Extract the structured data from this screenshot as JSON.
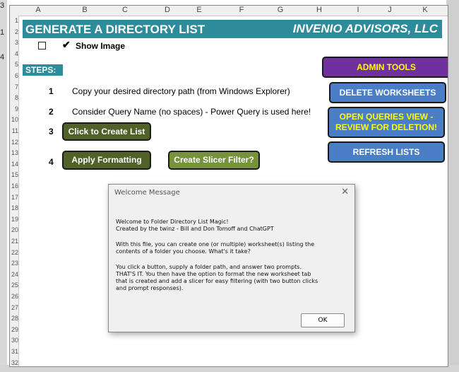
{
  "columns": [
    "A",
    "B",
    "C",
    "D",
    "E",
    "F",
    "G",
    "H",
    "I",
    "J",
    "K"
  ],
  "rows": [
    "1",
    "2",
    "3",
    "4",
    "5",
    "6",
    "7",
    "8",
    "9",
    "10",
    "11",
    "12",
    "13",
    "14",
    "15",
    "16",
    "17",
    "18",
    "19",
    "20",
    "21",
    "22",
    "23",
    "24",
    "25",
    "26",
    "27",
    "28",
    "29",
    "30",
    "31",
    "32"
  ],
  "left_fragments": [
    "3",
    "1",
    "4"
  ],
  "banner": {
    "title": "GENERATE A DIRECTORY LIST",
    "brand": "INVENIO ADVISORS, LLC"
  },
  "show_image": {
    "label": "Show Image",
    "check_glyph": "✔",
    "checked": false
  },
  "steps_label": "STEPS:",
  "steps": [
    {
      "num": "1",
      "text": "Copy your desired directory path (from Windows Explorer)"
    },
    {
      "num": "2",
      "text": "Consider Query Name (no spaces) - Power Query is used here!"
    },
    {
      "num": "3",
      "text": ""
    },
    {
      "num": "4",
      "text": ""
    }
  ],
  "buttons": {
    "create_list": "Click to Create List",
    "apply_formatting": "Apply Formatting",
    "create_slicer": "Create Slicer Filter?",
    "admin_tools": "ADMIN TOOLS",
    "delete_worksheets": "DELETE WORKSHEETS",
    "open_queries_line1": "OPEN QUERIES VIEW -",
    "open_queries_line2": "REVIEW FOR DELETION!",
    "refresh_lists": "REFRESH LISTS"
  },
  "dialog": {
    "title": "Welcome Message",
    "close_glyph": "✕",
    "lines": [
      "Welcome to Folder Directory List Magic!",
      "Created by the twinz - Bill and Don Tomoff and ChatGPT",
      "",
      "With this file, you can create one (or multiple) worksheet(s) listing the",
      "contents of a folder you choose. What's it take?",
      "",
      "You click a button, supply a folder path, and answer two prompts.",
      "THAT'S IT. You then have the option to format the new worksheet tab",
      "that is created and add a slicer for easy filtering (with two button clicks",
      "and prompt responses)."
    ],
    "ok_label": "OK"
  },
  "colors": {
    "banner": "#2e8b9a",
    "green_dark": "#4f6228",
    "green_light": "#76923c",
    "admin_purple": "#7030a0",
    "admin_blue": "#4a7ec7",
    "yellow_text": "#ffff00"
  }
}
